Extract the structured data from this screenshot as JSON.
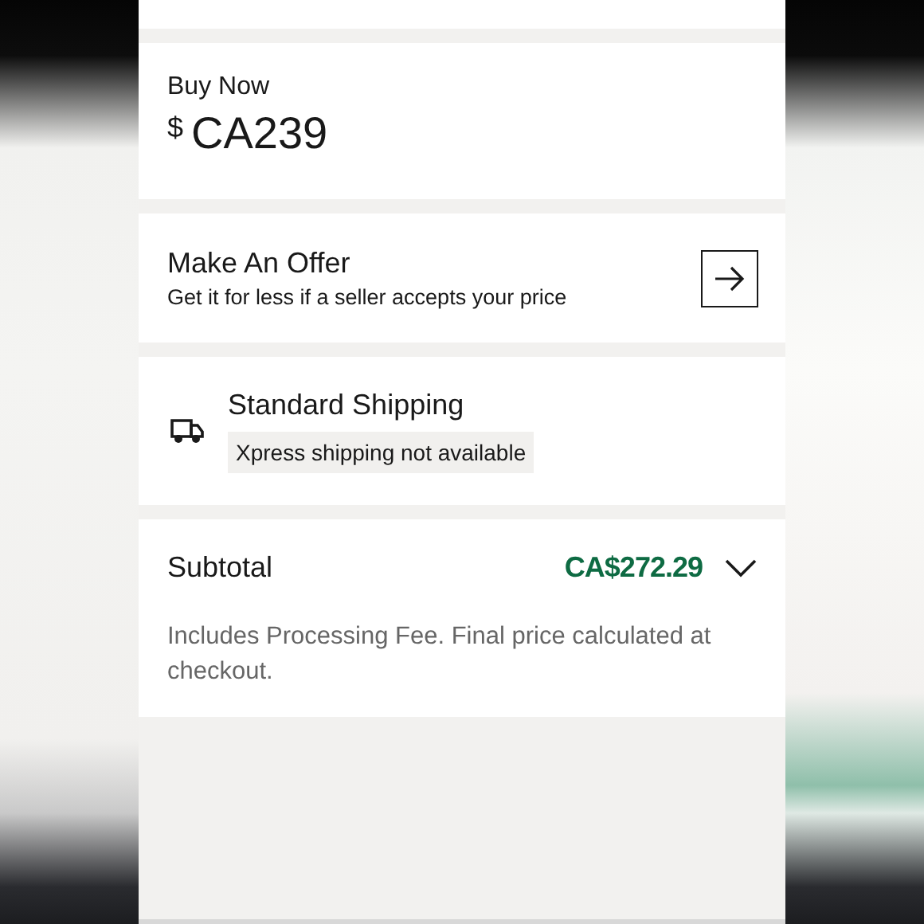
{
  "buy_now": {
    "label": "Buy Now",
    "currency_symbol": "$",
    "price": "CA239"
  },
  "offer": {
    "title": "Make An Offer",
    "subtitle": "Get it for less if a seller accepts your price"
  },
  "shipping": {
    "title": "Standard Shipping",
    "note": "Xpress shipping not available"
  },
  "subtotal": {
    "label": "Subtotal",
    "amount": "CA$272.29",
    "note": "Includes Processing Fee. Final price calculated at checkout."
  }
}
